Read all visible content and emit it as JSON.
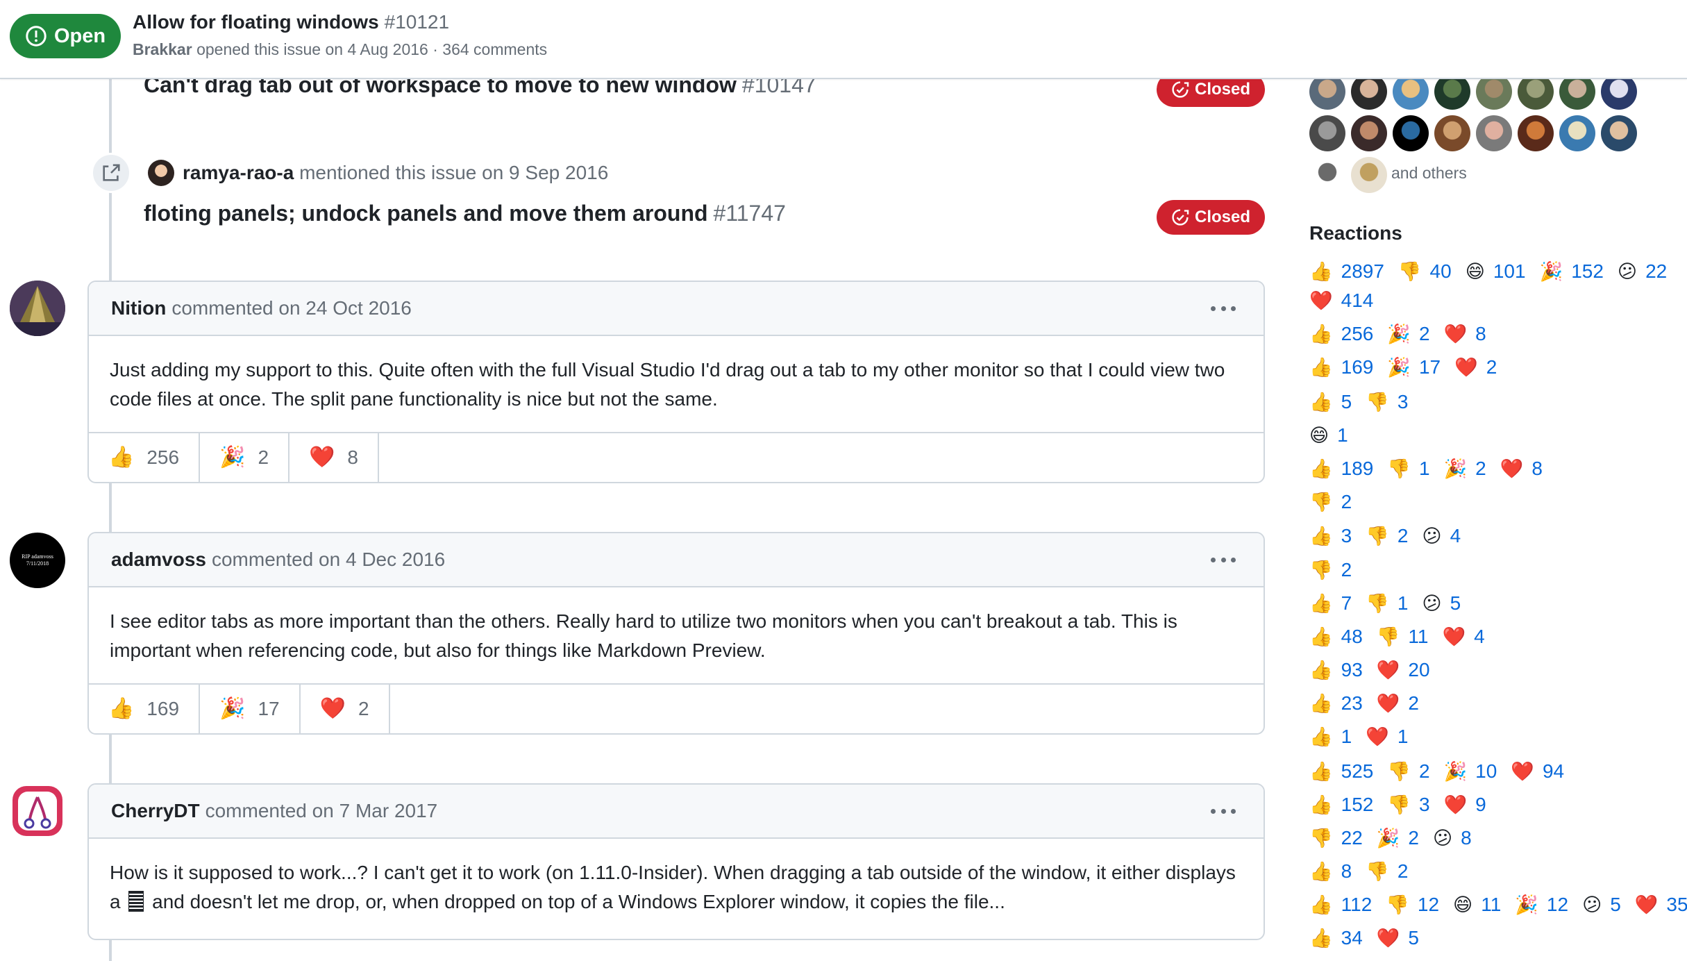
{
  "issue": {
    "state": "Open",
    "title": "Allow for floating windows",
    "number": "#10121",
    "author": "Brakkar",
    "meta": "opened this issue on 4 Aug 2016 · 364 comments"
  },
  "timeline": {
    "ref1": {
      "title": "Can't drag tab out of workspace to move to new window",
      "number": "#10147",
      "state": "Closed"
    },
    "mention": {
      "author": "ramya-rao-a",
      "text": "mentioned this issue on 9 Sep 2016"
    },
    "ref2": {
      "title": "floting panels; undock panels and move them around",
      "number": "#11747",
      "state": "Closed"
    }
  },
  "comments": [
    {
      "author": "Nition",
      "meta": "commented on 24 Oct 2016",
      "body": "Just adding my support to this. Quite often with the full Visual Studio I'd drag out a tab to my other monitor so that I could view two code files at once. The split pane functionality is nice but not the same.",
      "reactions": [
        {
          "emoji": "👍",
          "count": "256"
        },
        {
          "emoji": "🎉",
          "count": "2"
        },
        {
          "emoji": "❤️",
          "count": "8"
        }
      ]
    },
    {
      "author": "adamvoss",
      "avatar_text_1": "RIP adamvoss",
      "avatar_text_2": "7/11/2018",
      "meta": "commented on 4 Dec 2016",
      "body": "I see editor tabs as more important than the others. Really hard to utilize two monitors when you can't breakout a tab. This is important when referencing code, but also for things like Markdown Preview.",
      "reactions": [
        {
          "emoji": "👍",
          "count": "169"
        },
        {
          "emoji": "🎉",
          "count": "17"
        },
        {
          "emoji": "❤️",
          "count": "2"
        }
      ]
    },
    {
      "author": "CherryDT",
      "meta": "commented on 7 Mar 2017",
      "body_part1": "How is it supposed to work...? I can't get it to work (on 1.11.0-Insider). When dragging a tab outside of the window, it either displays a",
      "body_part2": "and doesn't let me drop, or, when dropped on top of a Windows Explorer window, it copies the file..."
    }
  ],
  "sidebar": {
    "and_others": "and others",
    "reactions_heading": "Reactions",
    "reaction_rows": [
      [
        [
          "👍",
          "2897"
        ],
        [
          "👎",
          "40"
        ],
        [
          "😄",
          "101"
        ],
        [
          "🎉",
          "152"
        ],
        [
          "😕",
          "22"
        ]
      ],
      [
        [
          "❤️",
          "414"
        ]
      ],
      [
        [
          "👍",
          "256"
        ],
        [
          "🎉",
          "2"
        ],
        [
          "❤️",
          "8"
        ]
      ],
      [
        [
          "👍",
          "169"
        ],
        [
          "🎉",
          "17"
        ],
        [
          "❤️",
          "2"
        ]
      ],
      [
        [
          "👍",
          "5"
        ],
        [
          "👎",
          "3"
        ]
      ],
      [
        [
          "😄",
          "1"
        ]
      ],
      [
        [
          "👍",
          "189"
        ],
        [
          "👎",
          "1"
        ],
        [
          "🎉",
          "2"
        ],
        [
          "❤️",
          "8"
        ]
      ],
      [
        [
          "👎",
          "2"
        ]
      ],
      [
        [
          "👍",
          "3"
        ],
        [
          "👎",
          "2"
        ],
        [
          "😕",
          "4"
        ]
      ],
      [
        [
          "👎",
          "2"
        ]
      ],
      [
        [
          "👍",
          "7"
        ],
        [
          "👎",
          "1"
        ],
        [
          "😕",
          "5"
        ]
      ],
      [
        [
          "👍",
          "48"
        ],
        [
          "👎",
          "11"
        ],
        [
          "❤️",
          "4"
        ]
      ],
      [
        [
          "👍",
          "93"
        ],
        [
          "❤️",
          "20"
        ]
      ],
      [
        [
          "👍",
          "23"
        ],
        [
          "❤️",
          "2"
        ]
      ],
      [
        [
          "👍",
          "1"
        ],
        [
          "❤️",
          "1"
        ]
      ],
      [
        [
          "👍",
          "525"
        ],
        [
          "👎",
          "2"
        ],
        [
          "🎉",
          "10"
        ],
        [
          "❤️",
          "94"
        ]
      ],
      [
        [
          "👍",
          "152"
        ],
        [
          "👎",
          "3"
        ],
        [
          "❤️",
          "9"
        ]
      ],
      [
        [
          "👎",
          "22"
        ],
        [
          "🎉",
          "2"
        ],
        [
          "😕",
          "8"
        ]
      ],
      [
        [
          "👍",
          "8"
        ],
        [
          "👎",
          "2"
        ]
      ],
      [
        [
          "👍",
          "112"
        ],
        [
          "👎",
          "12"
        ],
        [
          "😄",
          "11"
        ],
        [
          "🎉",
          "12"
        ],
        [
          "😕",
          "5"
        ],
        [
          "❤️",
          "35"
        ]
      ],
      [
        [
          "👍",
          "34"
        ],
        [
          "❤️",
          "5"
        ]
      ]
    ]
  },
  "colors": {
    "open_green": "#1f883d",
    "closed_red": "#cf222e",
    "link_blue": "#0969da",
    "border": "#d0d7de",
    "muted": "#656d76"
  }
}
